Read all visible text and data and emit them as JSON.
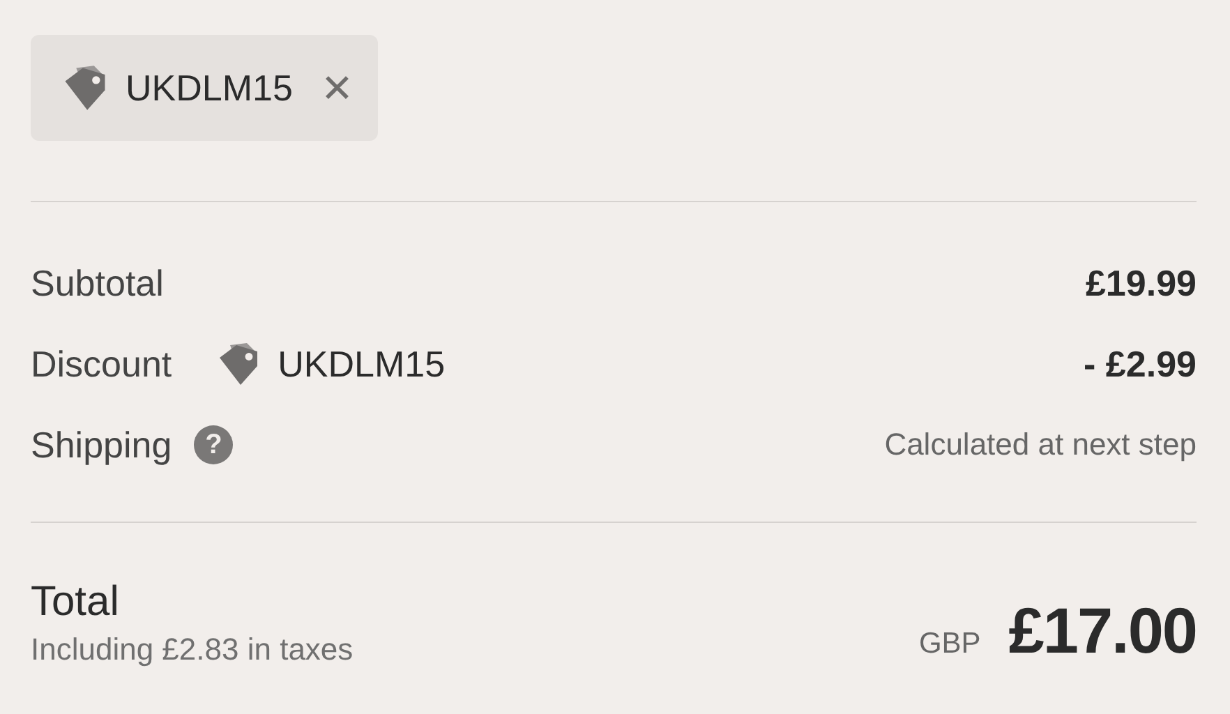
{
  "discount_chip": {
    "code": "UKDLM15",
    "remove": "✕"
  },
  "lines": [
    {
      "kind": "plain",
      "label": "Subtotal",
      "value": "£19.99"
    },
    {
      "kind": "discount",
      "label": "Discount",
      "code": "UKDLM15",
      "value": "- £2.99"
    },
    {
      "kind": "help",
      "label": "Shipping",
      "help": "?",
      "value": "Calculated at next step"
    }
  ],
  "total": {
    "label": "Total",
    "taxes": "Including £2.83 in taxes",
    "currency": "GBP",
    "amount": "£17.00"
  }
}
